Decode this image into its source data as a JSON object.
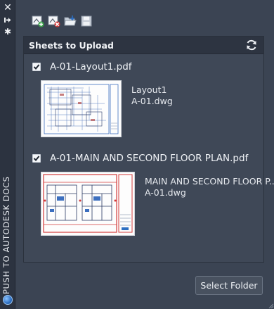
{
  "sidebar": {
    "title": "PUSH TO AUTODESK DOCS",
    "close_icon": "close-icon",
    "pin_icon": "pin-icon",
    "settings_icon": "gear-icon",
    "logo_icon": "autodesk-logo-icon"
  },
  "toolbar": {
    "buttons": [
      {
        "name": "add-sheets-icon"
      },
      {
        "name": "remove-sheets-icon"
      },
      {
        "name": "open-folder-icon"
      },
      {
        "name": "save-icon"
      }
    ]
  },
  "panel": {
    "title": "Sheets to Upload",
    "refresh_icon": "refresh-icon"
  },
  "sheets": [
    {
      "file": "A-01-Layout1.pdf",
      "checked": true,
      "layout": "Layout1",
      "dwg": "A-01.dwg"
    },
    {
      "file": "A-01-MAIN AND SECOND FLOOR PLAN.pdf",
      "checked": true,
      "layout": "MAIN AND SECOND FLOOR P...",
      "dwg": "A-01.dwg"
    }
  ],
  "footer": {
    "select_folder_label": "Select Folder"
  },
  "colors": {
    "background": "#3b4453",
    "header": "#2d3441",
    "panel": "#3f4857",
    "accent_blue": "#2d6fc2"
  }
}
